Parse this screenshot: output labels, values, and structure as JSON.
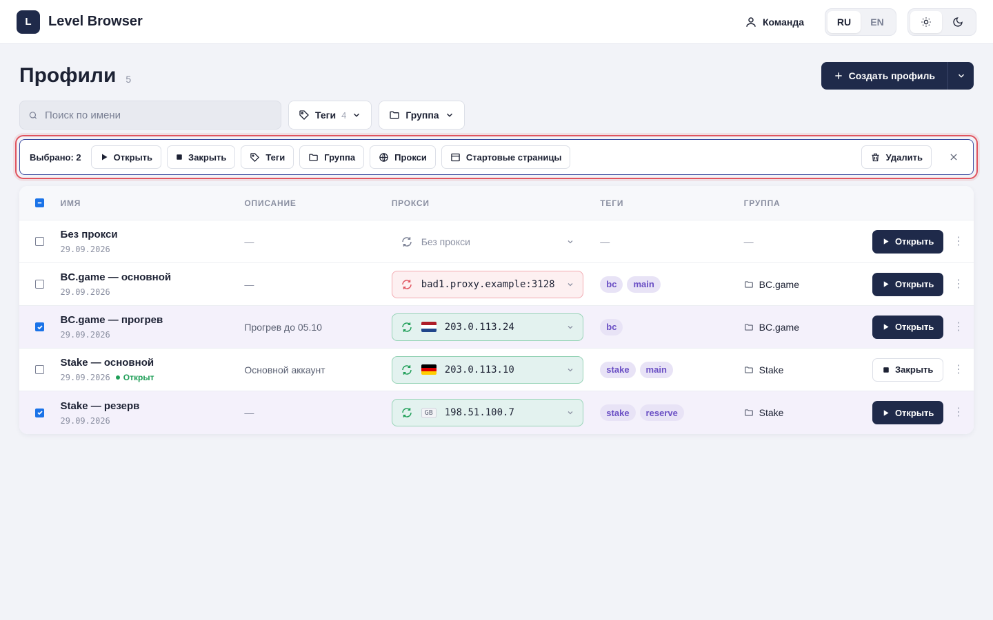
{
  "app": {
    "logo_letter": "L",
    "title": "Level Browser"
  },
  "top": {
    "team_label": "Команда",
    "languages": [
      "RU",
      "EN"
    ],
    "active_language": "RU",
    "theme_options": [
      "light-icon",
      "dark-icon"
    ],
    "active_theme": "light"
  },
  "page": {
    "title": "Профили",
    "count": "5"
  },
  "create": {
    "label": "Создать профиль"
  },
  "filters": {
    "search_placeholder": "Поиск по имени",
    "tags_label": "Теги",
    "tags_count": "4",
    "group_label": "Группа"
  },
  "bulk": {
    "selected_label": "Выбрано: 2",
    "open": "Открыть",
    "close": "Закрыть",
    "tags": "Теги",
    "group": "Группа",
    "proxy": "Прокси",
    "start_pages": "Стартовые страницы",
    "delete": "Удалить"
  },
  "table": {
    "headers": {
      "name": "ИМЯ",
      "description": "ОПИСАНИЕ",
      "proxy": "ПРОКСИ",
      "tags": "ТЕГИ",
      "group": "ГРУППА"
    },
    "header_checkbox": "partial",
    "rows": [
      {
        "selected": false,
        "name": "Без прокси",
        "date": "29.09.2026",
        "status": "",
        "description": "—",
        "proxy": {
          "state": "none",
          "text": "Без прокси",
          "country": ""
        },
        "tags": [],
        "group": "—",
        "action": "Открыть",
        "action_type": "open"
      },
      {
        "selected": false,
        "name": "BC.game — основной",
        "date": "29.09.2026",
        "status": "",
        "description": "—",
        "proxy": {
          "state": "bad",
          "text": "bad1.proxy.example:3128",
          "country": ""
        },
        "tags": [
          "bc",
          "main"
        ],
        "group": "BC.game",
        "action": "Открыть",
        "action_type": "open"
      },
      {
        "selected": true,
        "name": "BC.game — прогрев",
        "date": "29.09.2026",
        "status": "",
        "description": "Прогрев до 05.10",
        "proxy": {
          "state": "ok",
          "text": "203.0.113.24",
          "country": "NL"
        },
        "tags": [
          "bc"
        ],
        "group": "BC.game",
        "action": "Открыть",
        "action_type": "open"
      },
      {
        "selected": false,
        "name": "Stake — основной",
        "date": "29.09.2026",
        "status": "Открыт",
        "description": "Основной аккаунт",
        "proxy": {
          "state": "ok",
          "text": "203.0.113.10",
          "country": "DE"
        },
        "tags": [
          "stake",
          "main"
        ],
        "group": "Stake",
        "action": "Закрыть",
        "action_type": "close"
      },
      {
        "selected": true,
        "name": "Stake — резерв",
        "date": "29.09.2026",
        "status": "",
        "description": "—",
        "proxy": {
          "state": "ok",
          "text": "198.51.100.7",
          "country": "GB"
        },
        "tags": [
          "stake",
          "reserve"
        ],
        "group": "Stake",
        "action": "Открыть",
        "action_type": "open"
      }
    ]
  },
  "colors": {
    "primary": "#1f2a4a",
    "accent_red": "#e0535e",
    "ok_bg": "#e3f2ef",
    "bad_bg": "#fdf0f1",
    "tag_bg": "#e8e3f6",
    "tag_text": "#6a4fc4",
    "status_green": "#1e9e57"
  }
}
